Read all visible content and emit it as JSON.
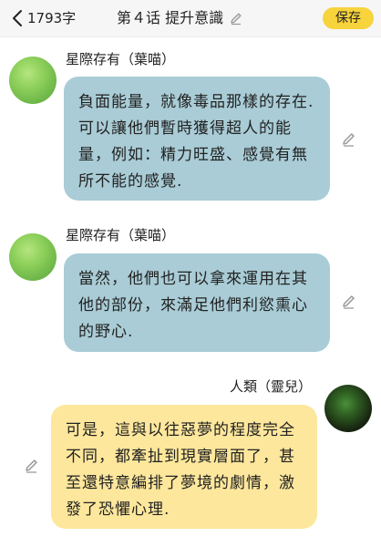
{
  "header": {
    "char_count": "1793字",
    "title": "第４话 提升意識",
    "save_label": "保存"
  },
  "messages": [
    {
      "sender": "星際存有（葉喵）",
      "side": "left",
      "text": "負面能量，就像毒品那樣的存在. 可以讓他們暫時獲得超人的能量，例如：精力旺盛、感覺有無所不能的感覺."
    },
    {
      "sender": "星際存有（葉喵）",
      "side": "left",
      "text": "當然，他們也可以拿來運用在其他的部份，來滿足他們利慾熏心的野心."
    },
    {
      "sender": "人類（靈兒）",
      "side": "right",
      "text": "可是，這與以往惡夢的程度完全不同，都牽扯到現實層面了，甚至還特意編排了夢境的劇情，激發了恐懼心理."
    }
  ],
  "colors": {
    "header_bg": "#f6f6f6",
    "save_button": "#f7d33c",
    "bubble_left": "#a9ccd6",
    "bubble_right": "#fde79c"
  },
  "icons": {
    "back": "chevron-left-icon",
    "edit": "pencil-icon"
  }
}
